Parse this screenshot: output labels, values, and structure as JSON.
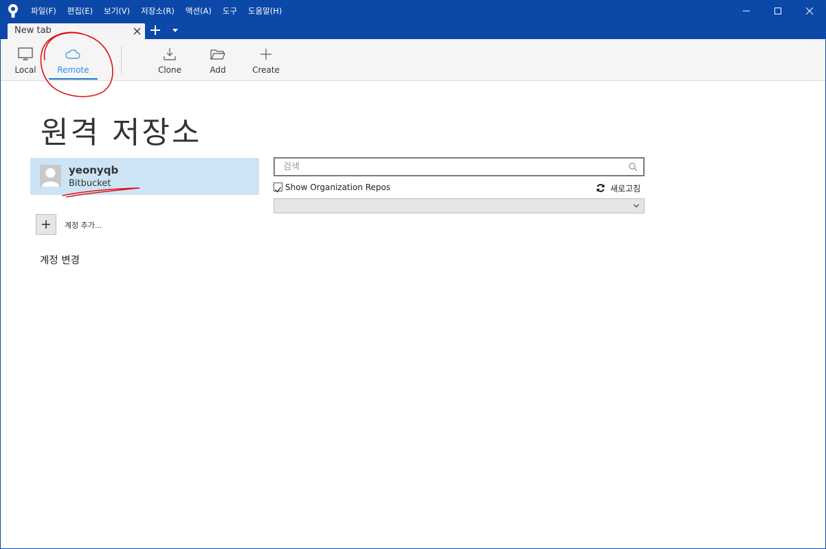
{
  "menu": {
    "items": [
      "파일(F)",
      "편집(E)",
      "보기(V)",
      "저장소(R)",
      "액션(A)",
      "도구",
      "도움말(H)"
    ]
  },
  "tabs": {
    "current": "New tab"
  },
  "toolbar": {
    "local_label": "Local",
    "remote_label": "Remote",
    "clone_label": "Clone",
    "add_label": "Add",
    "create_label": "Create",
    "active": "remote"
  },
  "main": {
    "title": "원격 저장소",
    "account": {
      "name": "yeonyqb",
      "service": "Bitbucket"
    },
    "add_account_label": "계정 추가...",
    "change_account_label": "계정 변경",
    "search_placeholder": "검색",
    "show_org_repos_label": "Show Organization Repos",
    "show_org_repos_checked": true,
    "refresh_label": "새로고침",
    "selected_value": ""
  },
  "colors": {
    "titlebar": "#0b48a8",
    "accent": "#2d8ee6",
    "selected_account_bg": "#cce4f6",
    "annotation": "#e01010"
  }
}
